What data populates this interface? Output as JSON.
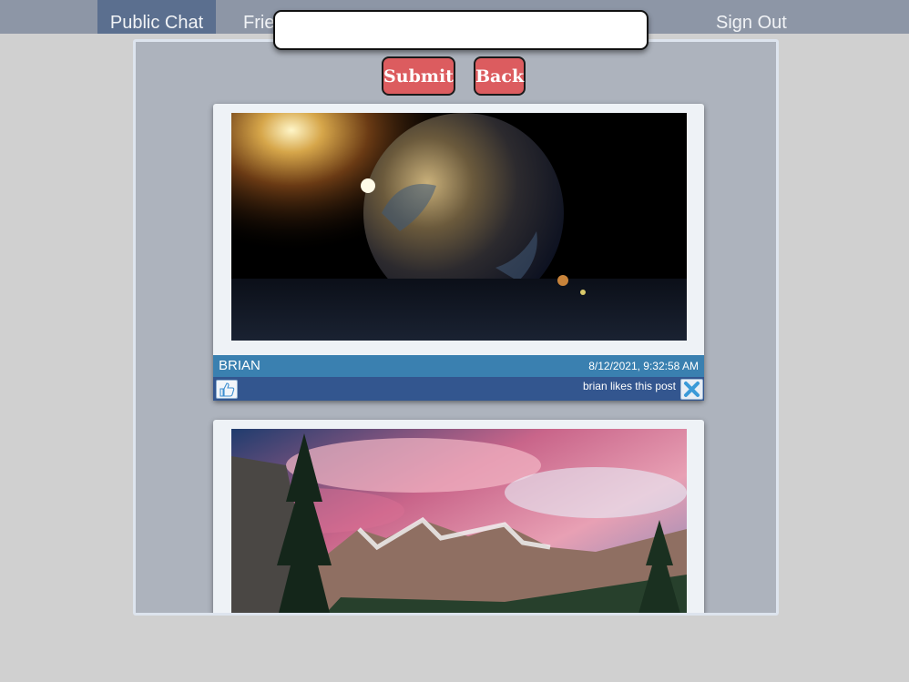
{
  "nav": {
    "tabs": [
      {
        "label": "Public Chat",
        "active": true
      },
      {
        "label": "Frie"
      }
    ],
    "signout_label": "Sign Out"
  },
  "search": {
    "value": ""
  },
  "buttons": {
    "submit_label": "Submit",
    "back_label": "Back"
  },
  "posts": [
    {
      "author": "BRIAN",
      "date": "8/12/2021, 9:32:58 AM",
      "likes_text": "brian likes this post",
      "image": "earth-in-space"
    },
    {
      "image": "mountain-landscape"
    }
  ],
  "colors": {
    "nav_bg": "#8d96a6",
    "nav_active": "#5b6f8f",
    "button_red": "#dc5c5f",
    "meta_bar": "#3a80b0",
    "action_bar": "#33568f"
  }
}
